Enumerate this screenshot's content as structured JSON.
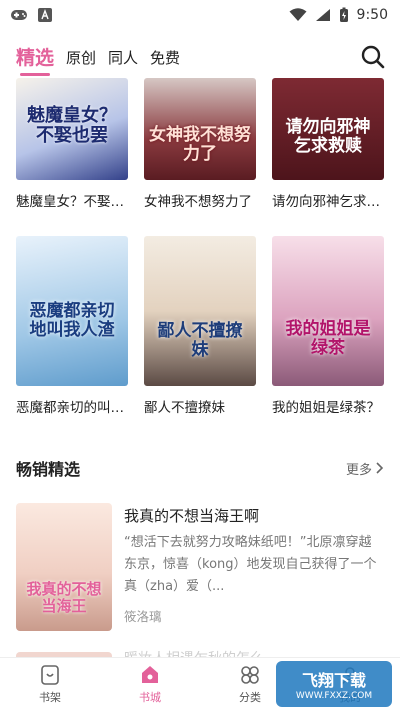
{
  "status_bar": {
    "time": "9:50"
  },
  "tabs": [
    {
      "label": "精选",
      "active": true
    },
    {
      "label": "原创",
      "active": false
    },
    {
      "label": "同人",
      "active": false
    },
    {
      "label": "免费",
      "active": false
    }
  ],
  "books": [
    {
      "title": "魅魔皇女？不娶也罢",
      "cover_text": "魅魔皇女？不娶也罢",
      "cover_color": "#3d4f8f"
    },
    {
      "title": "女神我不想努力了",
      "cover_text": "女神我不想努力了",
      "cover_color": "#7a2a2f"
    },
    {
      "title": "请勿向邪神乞求救赎",
      "cover_text": "请勿向邪神乞求救赎",
      "cover_color": "#5e1f26"
    },
    {
      "title": "恶魔都亲切的叫我人渣",
      "cover_text": "恶魔都亲切地叫我人渣",
      "cover_color": "#9fc7e6"
    },
    {
      "title": "鄙人不擅撩妹",
      "cover_text": "鄙人不擅撩妹",
      "cover_color": "#e9dccd"
    },
    {
      "title": "我的姐姐是绿茶？",
      "cover_text": "我的姐姐是绿茶",
      "cover_color": "#d9a9c1"
    }
  ],
  "section": {
    "title": "畅销精选",
    "more_label": "更多"
  },
  "feature": {
    "title": "我真的不想当海王啊",
    "description": "“想活下去就努力攻略妹纸吧！”北原凛穿越东京，惊喜（kong）地发现自己获得了一个真（zha）爱（...",
    "author": "筱洛璃",
    "cover_text": "我真的不想当海王",
    "cover_color": "#f3d8cf"
  },
  "next_item_peek": "暖妆人相遇乍秋的怎么",
  "bottom_nav": [
    {
      "label": "书架",
      "icon": "bookshelf-icon",
      "active": false
    },
    {
      "label": "书城",
      "icon": "bookstore-icon",
      "active": true
    },
    {
      "label": "分类",
      "icon": "category-icon",
      "active": false
    },
    {
      "label": "我的",
      "icon": "profile-icon",
      "active": false
    }
  ],
  "watermark": {
    "title": "飞翔下载",
    "url": "WWW.FXXZ.COM"
  },
  "colors": {
    "accent": "#e3619a"
  }
}
